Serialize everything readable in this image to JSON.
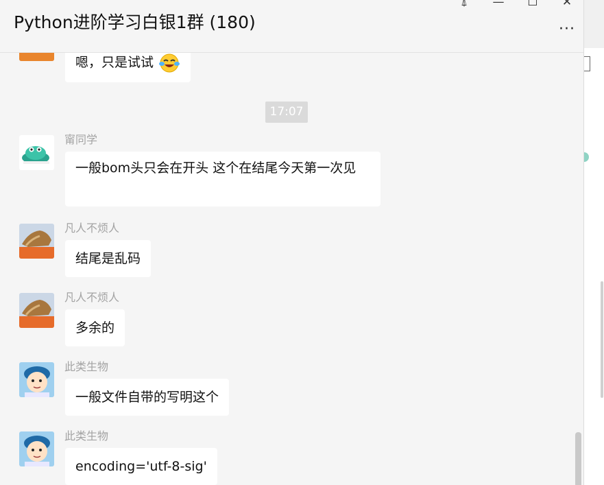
{
  "window": {
    "title": "Python进阶学习白银1群 (180)",
    "controls": {
      "pin": "⍋",
      "minimize": "—",
      "maximize": "☐",
      "close": "✕"
    },
    "more": "···"
  },
  "messages": [
    {
      "sender": "",
      "text": "嗯，只是试试",
      "emoji": "laughing-crying-emoji"
    },
    {
      "timestamp": "17:07"
    },
    {
      "sender": "甯同学",
      "text": "一般bom头只会在开头 这个在结尾今天第一次见"
    },
    {
      "sender": "凡人不烦人",
      "text": "结尾是乱码"
    },
    {
      "sender": "凡人不烦人",
      "text": "多余的"
    },
    {
      "sender": "此类生物",
      "text": "一般文件自带的写明这个"
    },
    {
      "sender": "此类生物",
      "text": "encoding='utf-8-sig'"
    }
  ]
}
